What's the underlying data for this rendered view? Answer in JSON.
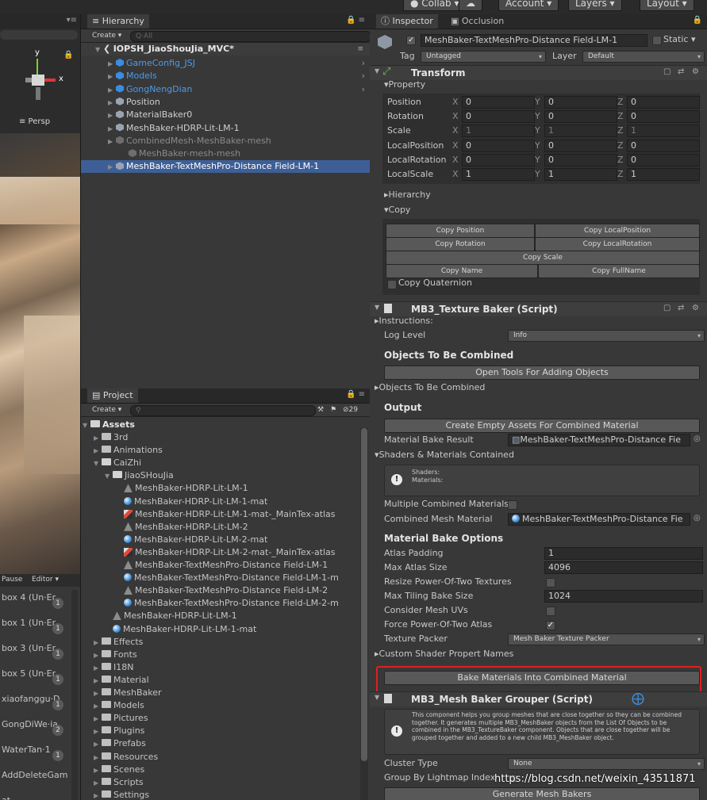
{
  "top_bar": {
    "collab": "Collab",
    "account": "Account",
    "layers": "Layers",
    "layout": "Layout"
  },
  "scene": {
    "persp_label": "≡ Persp",
    "axis_y": "y",
    "axis_x": "x"
  },
  "lower_left": {
    "pause": "Pause",
    "editor": "Editor",
    "items": [
      {
        "label": "box 4 (Un·Er",
        "badge": "1"
      },
      {
        "label": "box 1 (Un·Er",
        "badge": "1"
      },
      {
        "label": "box 3 (Un·Er",
        "badge": "1"
      },
      {
        "label": "box 5 (Un·Er",
        "badge": "1"
      },
      {
        "label": "xiaofanggu·D",
        "badge": "1"
      },
      {
        "label": "GongDiWe·ia",
        "badge": "2"
      },
      {
        "label": "WaterTan·1",
        "badge": "1"
      },
      {
        "label": "AddDeleteGam",
        "badge": ""
      },
      {
        "label": "at",
        "badge": ""
      }
    ]
  },
  "hierarchy": {
    "tab": "Hierarchy",
    "create": "Create",
    "search_placeholder": "Q·All",
    "scene_name": "IOPSH_JiaoShouJia_MVC*",
    "rows": [
      {
        "label": "GameConfig_JSJ",
        "kind": "blue"
      },
      {
        "label": "Models",
        "kind": "blue"
      },
      {
        "label": "GongNengDian",
        "kind": "blue"
      },
      {
        "label": "Position",
        "kind": "plain"
      },
      {
        "label": "MaterialBaker0",
        "kind": "plain"
      },
      {
        "label": "MeshBaker-HDRP-Lit-LM-1",
        "kind": "plain"
      },
      {
        "label": "CombinedMesh-MeshBaker-mesh",
        "kind": "dim"
      },
      {
        "label": "MeshBaker-mesh-mesh",
        "kind": "dim"
      },
      {
        "label": "MeshBaker-TextMeshPro-Distance Field-LM-1",
        "kind": "selected"
      }
    ]
  },
  "project": {
    "tab": "Project",
    "create": "Create",
    "count": "29",
    "assets": "Assets",
    "rows": [
      {
        "label": "3rd",
        "icon": "folder",
        "indent": 1
      },
      {
        "label": "Animations",
        "icon": "folder",
        "indent": 1
      },
      {
        "label": "CaiZhi",
        "icon": "folder-open",
        "indent": 1
      },
      {
        "label": "JiaoSHouJia",
        "icon": "folder-open",
        "indent": 2
      },
      {
        "label": "MeshBaker-HDRP-Lit-LM-1",
        "icon": "mesh",
        "indent": 3
      },
      {
        "label": "MeshBaker-HDRP-Lit-LM-1-mat",
        "icon": "ball",
        "indent": 3
      },
      {
        "label": "MeshBaker-HDRP-Lit-LM-1-mat-_MainTex-atlas",
        "icon": "tex",
        "indent": 3
      },
      {
        "label": "MeshBaker-HDRP-Lit-LM-2",
        "icon": "mesh",
        "indent": 3
      },
      {
        "label": "MeshBaker-HDRP-Lit-LM-2-mat",
        "icon": "ball",
        "indent": 3
      },
      {
        "label": "MeshBaker-HDRP-Lit-LM-2-mat-_MainTex-atlas",
        "icon": "tex",
        "indent": 3
      },
      {
        "label": "MeshBaker-TextMeshPro-Distance Field-LM-1",
        "icon": "mesh",
        "indent": 3
      },
      {
        "label": "MeshBaker-TextMeshPro-Distance Field-LM-1-m",
        "icon": "ball",
        "indent": 3
      },
      {
        "label": "MeshBaker-TextMeshPro-Distance Field-LM-2",
        "icon": "mesh",
        "indent": 3
      },
      {
        "label": "MeshBaker-TextMeshPro-Distance Field-LM-2-m",
        "icon": "ball",
        "indent": 3
      },
      {
        "label": "MeshBaker-HDRP-Lit-LM-1",
        "icon": "mesh",
        "indent": 2
      },
      {
        "label": "MeshBaker-HDRP-Lit-LM-1-mat",
        "icon": "ball",
        "indent": 2
      },
      {
        "label": "Effects",
        "icon": "folder",
        "indent": 1
      },
      {
        "label": "Fonts",
        "icon": "folder",
        "indent": 1
      },
      {
        "label": "I18N",
        "icon": "folder",
        "indent": 1
      },
      {
        "label": "Material",
        "icon": "folder",
        "indent": 1
      },
      {
        "label": "MeshBaker",
        "icon": "folder",
        "indent": 1
      },
      {
        "label": "Models",
        "icon": "folder",
        "indent": 1
      },
      {
        "label": "Pictures",
        "icon": "folder",
        "indent": 1
      },
      {
        "label": "Plugins",
        "icon": "folder",
        "indent": 1
      },
      {
        "label": "Prefabs",
        "icon": "folder",
        "indent": 1
      },
      {
        "label": "Resources",
        "icon": "folder",
        "indent": 1
      },
      {
        "label": "Scenes",
        "icon": "folder",
        "indent": 1
      },
      {
        "label": "Scripts",
        "icon": "folder",
        "indent": 1
      },
      {
        "label": "Settings",
        "icon": "folder",
        "indent": 1
      }
    ]
  },
  "inspector": {
    "tab_inspector": "Inspector",
    "tab_occlusion": "Occlusion",
    "object_name": "MeshBaker-TextMeshPro-Distance Field-LM-1",
    "static": "Static",
    "tag_label": "Tag",
    "tag_value": "Untagged",
    "layer_label": "Layer",
    "layer_value": "Default",
    "transform": {
      "title": "Transform",
      "property": "Property",
      "rows": [
        {
          "label": "Position",
          "x": "0",
          "y": "0",
          "z": "0",
          "dim": false
        },
        {
          "label": "Rotation",
          "x": "0",
          "y": "0",
          "z": "0",
          "dim": false
        },
        {
          "label": "Scale",
          "x": "1",
          "y": "1",
          "z": "1",
          "dim": true
        },
        {
          "label": "LocalPosition",
          "x": "0",
          "y": "0",
          "z": "0",
          "dim": false
        },
        {
          "label": "LocalRotation",
          "x": "0",
          "y": "0",
          "z": "0",
          "dim": false
        },
        {
          "label": "LocalScale",
          "x": "1",
          "y": "1",
          "z": "1",
          "dim": false
        }
      ],
      "hierarchy": "Hierarchy",
      "copy": "Copy",
      "copy_position": "Copy Position",
      "copy_local_position": "Copy LocalPosition",
      "copy_rotation": "Copy Rotation",
      "copy_local_rotation": "Copy LocalRotation",
      "copy_scale": "Copy Scale",
      "copy_name": "Copy Name",
      "copy_full_name": "Copy FullName",
      "copy_quaternion": "Copy Quaternion"
    },
    "texture_baker": {
      "title": "MB3_Texture Baker (Script)",
      "instructions": "Instructions:",
      "log_level_label": "Log Level",
      "log_level_value": "Info",
      "objects_heading": "Objects To Be Combined",
      "open_tools": "Open Tools For Adding Objects",
      "objects_foldout": "Objects To Be Combined",
      "output_heading": "Output",
      "create_empty": "Create Empty Assets For Combined Material",
      "bake_result_label": "Material Bake Result",
      "bake_result_value": "MeshBaker-TextMeshPro-Distance Fie",
      "shaders_foldout": "Shaders & Materials Contained",
      "shaders_label": "Shaders:",
      "materials_label": "Materials:",
      "multiple_combined": "Multiple Combined Materials",
      "combined_mesh_material_label": "Combined Mesh Material",
      "combined_mesh_material_value": "MeshBaker-TextMeshPro-Distance Fie",
      "options_heading": "Material Bake Options",
      "atlas_padding_label": "Atlas Padding",
      "atlas_padding_value": "1",
      "max_atlas_label": "Max Atlas Size",
      "max_atlas_value": "4096",
      "resize_pot_label": "Resize Power-Of-Two Textures",
      "max_tiling_label": "Max Tiling Bake Size",
      "max_tiling_value": "1024",
      "consider_uvs_label": "Consider Mesh UVs",
      "force_pot_label": "Force Power-Of-Two Atlas",
      "texture_packer_label": "Texture Packer",
      "texture_packer_value": "Mesh Baker Texture Packer",
      "custom_shader": "Custom Shader Propert Names",
      "bake_button": "Bake Materials Into Combined Material"
    },
    "grouper": {
      "title": "MB3_Mesh Baker Grouper (Script)",
      "help": "This component helps you group meshes that are close together so they can be combined together. It generates multiple MB3_MeshBaker objects from the List Of Objects to be combined in the MB3_TextureBaker component. Objects that are close together will be grouped together and added to a new child MB3_MeshBaker object.",
      "cluster_type_label": "Cluster Type",
      "cluster_type_value": "None",
      "group_lightmap_label": "Group By Lightmap Index",
      "generate_button": "Generate Mesh Bakers"
    }
  },
  "watermark": "https://blog.csdn.net/weixin_43511871",
  "colors": {
    "selection": "#3e5f96",
    "highlight_border": "#e02020",
    "link_blue": "#3a8de0"
  }
}
